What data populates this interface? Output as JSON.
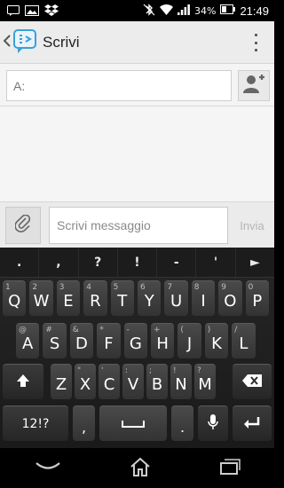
{
  "status_bar": {
    "battery": "34%",
    "time": "21:49",
    "icons": [
      "sms-notification-icon",
      "image-notification-icon",
      "dropbox-icon",
      "bluetooth-muted-icon",
      "wifi-icon",
      "signal-icon",
      "battery-icon"
    ]
  },
  "app_bar": {
    "title": "Scrivi",
    "back_icon": "chevron-left-icon",
    "app_icon": "messaging-icon",
    "overflow_icon": "overflow-menu-icon"
  },
  "recipient": {
    "placeholder": "A:",
    "add_contact_icon": "add-contact-icon"
  },
  "compose": {
    "placeholder": "Scrivi messaggio",
    "send_label": "Invia",
    "attach_icon": "paperclip-icon"
  },
  "keyboard": {
    "punctuation": [
      ".",
      ",",
      "?",
      "!",
      "-",
      "'",
      "►"
    ],
    "row1": [
      {
        "main": "Q",
        "sub": "1"
      },
      {
        "main": "W",
        "sub": "2"
      },
      {
        "main": "E",
        "sub": "3"
      },
      {
        "main": "R",
        "sub": "4"
      },
      {
        "main": "T",
        "sub": "5"
      },
      {
        "main": "Y",
        "sub": "6"
      },
      {
        "main": "U",
        "sub": "7"
      },
      {
        "main": "I",
        "sub": "8"
      },
      {
        "main": "O",
        "sub": "9"
      },
      {
        "main": "P",
        "sub": "0"
      }
    ],
    "row2": [
      {
        "main": "A",
        "sub": "@"
      },
      {
        "main": "S",
        "sub": "#"
      },
      {
        "main": "D",
        "sub": "&"
      },
      {
        "main": "F",
        "sub": "*"
      },
      {
        "main": "G",
        "sub": "-"
      },
      {
        "main": "H",
        "sub": "+"
      },
      {
        "main": "J",
        "sub": "("
      },
      {
        "main": "K",
        "sub": ")"
      },
      {
        "main": "L",
        "sub": "/"
      }
    ],
    "row3": [
      {
        "main": "Z",
        "sub": ""
      },
      {
        "main": "X",
        "sub": "\""
      },
      {
        "main": "C",
        "sub": "'"
      },
      {
        "main": "V",
        "sub": ":"
      },
      {
        "main": "B",
        "sub": ";"
      },
      {
        "main": "N",
        "sub": "!"
      },
      {
        "main": "M",
        "sub": "?"
      }
    ],
    "symbols_label": "12!?",
    "comma_label": ",",
    "period_label": "."
  },
  "nav_bar": {
    "icons": [
      "back-icon",
      "home-icon",
      "recent-apps-icon"
    ]
  }
}
